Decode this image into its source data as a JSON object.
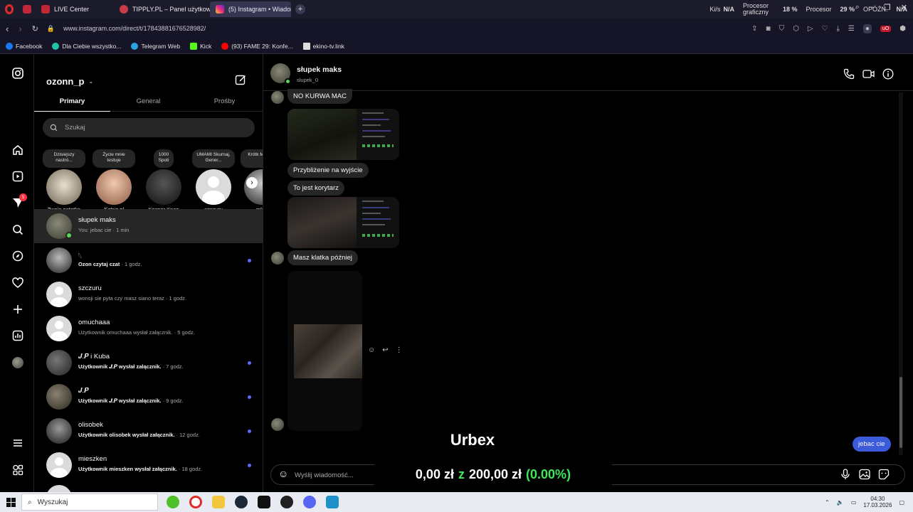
{
  "browser": {
    "tabs": [
      {
        "label": "LIVE Center",
        "color": "#c0283a"
      },
      {
        "label": "TIPPLY.PL – Panel użytkow",
        "color": "#c93a4a"
      },
      {
        "label": "(5) Instagram • Wiadomości",
        "color": "#d6249f",
        "active": true
      }
    ],
    "url": "www.instagram.com/direct/t/17843881676528982/",
    "stats": {
      "net_label": "Ki/s",
      "net_value": "N/A",
      "gpu_label": "Procesor graficzny",
      "gpu_value": "18 %",
      "cpu_label": "Procesor",
      "cpu_value": "29 %",
      "delay_label": "OPÓŹN.",
      "delay_value": "N/A"
    },
    "bookmarks": [
      {
        "label": "Facebook",
        "color": "#1877f2"
      },
      {
        "label": "Dla Ciebie wszystko...",
        "color": "#22c3a6"
      },
      {
        "label": "Telegram Web",
        "color": "#2aa3e0"
      },
      {
        "label": "Kick",
        "color": "#53fc18"
      },
      {
        "label": "(93) FAME 29: Konfe...",
        "color": "#ff0000"
      },
      {
        "label": "ekino-tv.link",
        "color": "#dddddd"
      }
    ]
  },
  "inbox": {
    "username": "ozonn_p",
    "tabs": [
      "Primary",
      "General",
      "Prośby"
    ],
    "active_tab": "Primary",
    "search_placeholder": "Szukaj",
    "notes": [
      {
        "bubble": "Dzisiejszy nastró...",
        "label": "Twoja notatka"
      },
      {
        "bubble": "Życie mnie testuje",
        "label": "𝐾𝑎𝑡𝑟𝑖𝑛.𝑝𝑙"
      },
      {
        "bubble": "1000 Spoti",
        "label": "Kacper Knap"
      },
      {
        "bubble": "UMAMI Skurnaj, Gener...",
        "label": "szczuru"
      },
      {
        "bubble": "Krótk Major S",
        "label": "mlod"
      }
    ],
    "conversations": [
      {
        "name": "słupek maks",
        "sub": "You: jebac cie · 1 min",
        "bold": "",
        "unread": false
      },
      {
        "name": "𓆩",
        "bold": "Ozon czytaj czat",
        "sub": " · 1 godz.",
        "unread": true
      },
      {
        "name": "szczuru",
        "sub": "wonsji sie pyta czy masz siano teraz · 1 godz.",
        "bold": "",
        "unread": false
      },
      {
        "name": "omuchaaa",
        "sub": "Użytkownik omuchaaa wysłał załącznik. · 5 godz.",
        "bold": "",
        "unread": false
      },
      {
        "name": "𝑱.𝑷 i Kuba",
        "bold": "Użytkownik 𝑱.𝑷 wysłał załącznik.",
        "sub": " · 7 godz.",
        "unread": true
      },
      {
        "name": "𝑱.𝑷",
        "bold": "Użytkownik 𝑱.𝑷 wysłał załącznik.",
        "sub": " · 9 godz.",
        "unread": true
      },
      {
        "name": "olisobek",
        "bold": "Użytkownik olisobek wysłał załącznik.",
        "sub": " · 12 godz.",
        "unread": true
      },
      {
        "name": "mieszken",
        "bold": "Użytkownik mieszken wysłał załącznik.",
        "sub": " · 18 godz.",
        "unread": true
      }
    ]
  },
  "chat": {
    "contact_name": "słupek maks",
    "contact_handle": "slupek_0",
    "messages": [
      {
        "text": "NO KURWA MAC"
      },
      {
        "text": "Przybliżenie na wyjście"
      },
      {
        "text": "To jest korytarz"
      },
      {
        "text": "Masz klatka później"
      }
    ],
    "sent_message": "jebac cie",
    "composer_placeholder": "Wyślij wiadomość...",
    "overlay_title": "Urbex",
    "overlay_amount": "0,00 zł",
    "overlay_z": "z",
    "overlay_goal": "200,00 zł",
    "overlay_pct": "(0.00%)",
    "overlay_pct_color": "#3ee65a"
  },
  "rail_badge": "5",
  "taskbar": {
    "search": "Wyszukaj",
    "time": "04:30",
    "date": "17.03.2026"
  }
}
